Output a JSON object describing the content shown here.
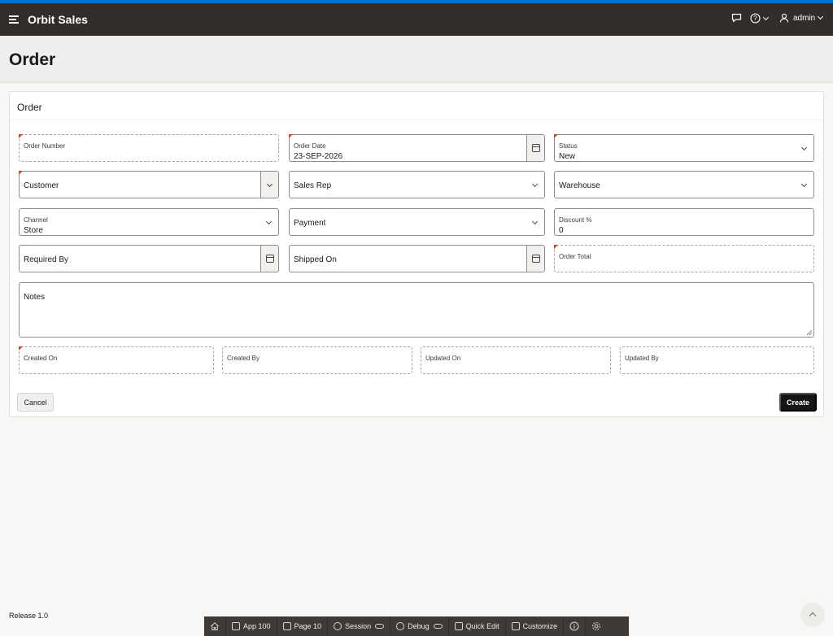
{
  "header": {
    "app_title": "Orbit Sales",
    "user": "admin"
  },
  "page": {
    "title": "Order"
  },
  "region": {
    "title": "Order"
  },
  "form": {
    "order_number": {
      "label": "Order Number"
    },
    "order_date": {
      "label": "Order Date",
      "value": "23-SEP-2026"
    },
    "status": {
      "label": "Status",
      "value": "New"
    },
    "customer": {
      "label": "Customer"
    },
    "sales_rep": {
      "label": "Sales Rep"
    },
    "warehouse": {
      "label": "Warehouse"
    },
    "channel": {
      "label": "Channel",
      "value": "Store"
    },
    "payment": {
      "label": "Payment"
    },
    "discount": {
      "label": "Discount %",
      "value": "0"
    },
    "required_by": {
      "label": "Required By"
    },
    "shipped_on": {
      "label": "Shipped On"
    },
    "order_total": {
      "label": "Order Total"
    },
    "notes": {
      "label": "Notes"
    },
    "created_on": {
      "label": "Created On"
    },
    "created_by": {
      "label": "Created By"
    },
    "updated_on": {
      "label": "Updated On"
    },
    "updated_by": {
      "label": "Updated By"
    }
  },
  "buttons": {
    "cancel": "Cancel",
    "create": "Create"
  },
  "footer": {
    "release": "Release 1.0"
  },
  "devbar": {
    "app": "App 100",
    "page": "Page 10",
    "session": "Session",
    "debug": "Debug",
    "quick_edit": "Quick Edit",
    "customize": "Customize"
  },
  "colors": {
    "header_bg": "#312d2a",
    "accent_stripe": "#0572ce",
    "required_marker": "#c74634",
    "primary_button": "#161513"
  }
}
